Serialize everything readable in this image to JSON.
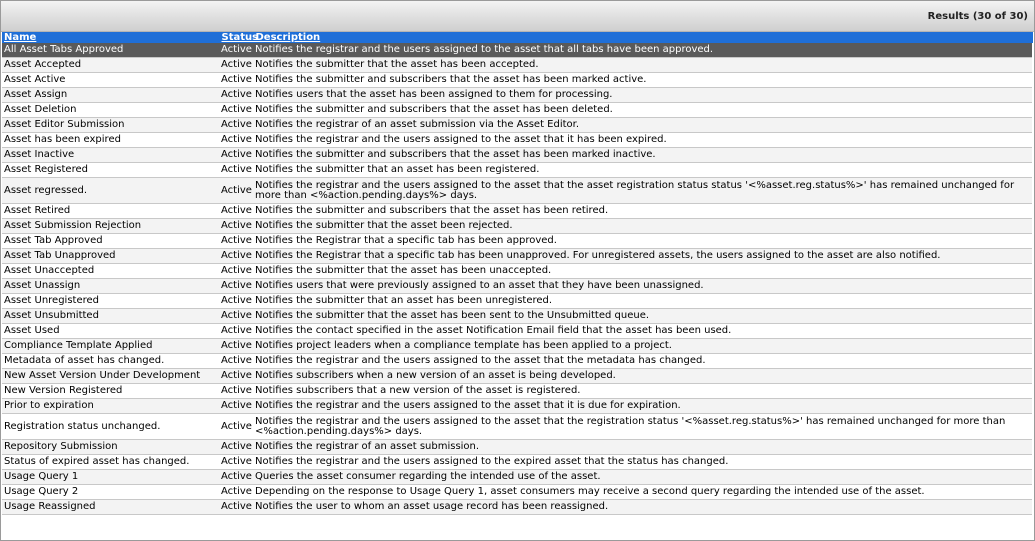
{
  "results_label": "Results (30 of 30)",
  "columns": {
    "name": "Name",
    "status": "Status",
    "description": "Description"
  },
  "rows": [
    {
      "name": "All Asset Tabs Approved",
      "status": "Active",
      "description": "Notifies the registrar and the users assigned to the asset that all tabs have been approved."
    },
    {
      "name": "Asset Accepted",
      "status": "Active",
      "description": "Notifies the submitter that the asset has been accepted."
    },
    {
      "name": "Asset Active",
      "status": "Active",
      "description": "Notifies the submitter and subscribers that the asset has been marked active."
    },
    {
      "name": "Asset Assign",
      "status": "Active",
      "description": "Notifies users that the asset has been assigned to them for processing."
    },
    {
      "name": "Asset Deletion",
      "status": "Active",
      "description": "Notifies the submitter and subscribers that the asset has been deleted."
    },
    {
      "name": "Asset Editor Submission",
      "status": "Active",
      "description": "Notifies the registrar of an asset submission via the Asset Editor."
    },
    {
      "name": "Asset has been expired",
      "status": "Active",
      "description": "Notifies the registrar and the users assigned to the asset that it has been expired."
    },
    {
      "name": "Asset Inactive",
      "status": "Active",
      "description": "Notifies the submitter and subscribers that the asset has been marked inactive."
    },
    {
      "name": "Asset Registered",
      "status": "Active",
      "description": "Notifies the submitter that an asset has been registered."
    },
    {
      "name": "Asset regressed.",
      "status": "Active",
      "description": "Notifies the registrar and the users assigned to the asset that the asset registration status status '<%asset.reg.status%>' has remained unchanged for more than <%action.pending.days%> days."
    },
    {
      "name": "Asset Retired",
      "status": "Active",
      "description": "Notifies the submitter and subscribers that the asset has been retired."
    },
    {
      "name": "Asset Submission Rejection",
      "status": "Active",
      "description": "Notifies the submitter that the asset been rejected."
    },
    {
      "name": "Asset Tab Approved",
      "status": "Active",
      "description": "Notifies the Registrar that a specific tab has been approved."
    },
    {
      "name": "Asset Tab Unapproved",
      "status": "Active",
      "description": "Notifies the Registrar that a specific tab has been unapproved. For unregistered assets, the users assigned to the asset are also notified."
    },
    {
      "name": "Asset Unaccepted",
      "status": "Active",
      "description": "Notifies the submitter that the asset has been unaccepted."
    },
    {
      "name": "Asset Unassign",
      "status": "Active",
      "description": "Notifies users that were previously assigned to an asset that they have been unassigned."
    },
    {
      "name": "Asset Unregistered",
      "status": "Active",
      "description": "Notifies the submitter that an asset has been unregistered."
    },
    {
      "name": "Asset Unsubmitted",
      "status": "Active",
      "description": "Notifies the submitter that the asset has been sent to the Unsubmitted queue."
    },
    {
      "name": "Asset Used",
      "status": "Active",
      "description": "Notifies the contact specified in the asset Notification Email field that the asset has been used."
    },
    {
      "name": "Compliance Template Applied",
      "status": "Active",
      "description": "Notifies project leaders when a compliance template has been applied to a project."
    },
    {
      "name": "Metadata of asset has changed.",
      "status": "Active",
      "description": "Notifies the registrar and the users assigned to the asset that the metadata has changed."
    },
    {
      "name": "New Asset Version Under Development",
      "status": "Active",
      "description": "Notifies subscribers when a new version of an asset is being developed."
    },
    {
      "name": "New Version Registered",
      "status": "Active",
      "description": "Notifies subscribers that a new version of the asset is registered."
    },
    {
      "name": "Prior to expiration",
      "status": "Active",
      "description": "Notifies the registrar and the users assigned to the asset that it is due for expiration."
    },
    {
      "name": "Registration status unchanged.",
      "status": "Active",
      "description": "Notifies the registrar and the users assigned to the asset that the registration status '<%asset.reg.status%>' has remained unchanged for more than <%action.pending.days%> days."
    },
    {
      "name": "Repository Submission",
      "status": "Active",
      "description": "Notifies the registrar of an asset submission."
    },
    {
      "name": "Status of expired asset has changed.",
      "status": "Active",
      "description": "Notifies the registrar and the users assigned to the expired asset that the status has changed."
    },
    {
      "name": "Usage Query 1",
      "status": "Active",
      "description": "Queries the asset consumer regarding the intended use of the asset."
    },
    {
      "name": "Usage Query 2",
      "status": "Active",
      "description": "Depending on the response to Usage Query 1, asset consumers may receive a second query regarding the intended use of the asset."
    },
    {
      "name": "Usage Reassigned",
      "status": "Active",
      "description": "Notifies the user to whom an asset usage record has been reassigned."
    }
  ]
}
